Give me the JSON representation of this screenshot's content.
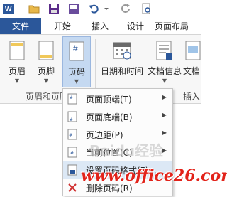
{
  "colors": {
    "accent": "#2b579a",
    "watermark": "#e2231a",
    "active": "#c5d9f1"
  },
  "qat": {
    "icons": [
      "word-logo-icon",
      "open-folder-icon",
      "save-icon",
      "save-copy-icon",
      "undo-icon",
      "redo-icon",
      "repeat-icon",
      "print-preview-icon"
    ]
  },
  "tabs": [
    {
      "label": "文件"
    },
    {
      "label": "开始"
    },
    {
      "label": "插入"
    },
    {
      "label": "设计"
    },
    {
      "label": "页面布局"
    }
  ],
  "ribbon": {
    "header_label": "页眉",
    "footer_label": "页脚",
    "page_number_label": "页码",
    "datetime_label": "日期和时间",
    "docinfo_label": "文档信息",
    "docpart_label": "文档",
    "group1_label": "页眉和页脚",
    "group2_label": "插入"
  },
  "menu": {
    "items": [
      {
        "label": "页面顶端(T)",
        "has_submenu": true
      },
      {
        "label": "页面底端(B)",
        "has_submenu": true
      },
      {
        "label": "页边距(P)",
        "has_submenu": true
      },
      {
        "label": "当前位置(C)",
        "has_submenu": true
      },
      {
        "label": "设置页码格式(F)...",
        "has_submenu": false
      },
      {
        "label": "删除页码(R)",
        "has_submenu": false
      }
    ]
  },
  "watermark": {
    "text": "www.office26.com",
    "baidu": "Baidu经验"
  }
}
